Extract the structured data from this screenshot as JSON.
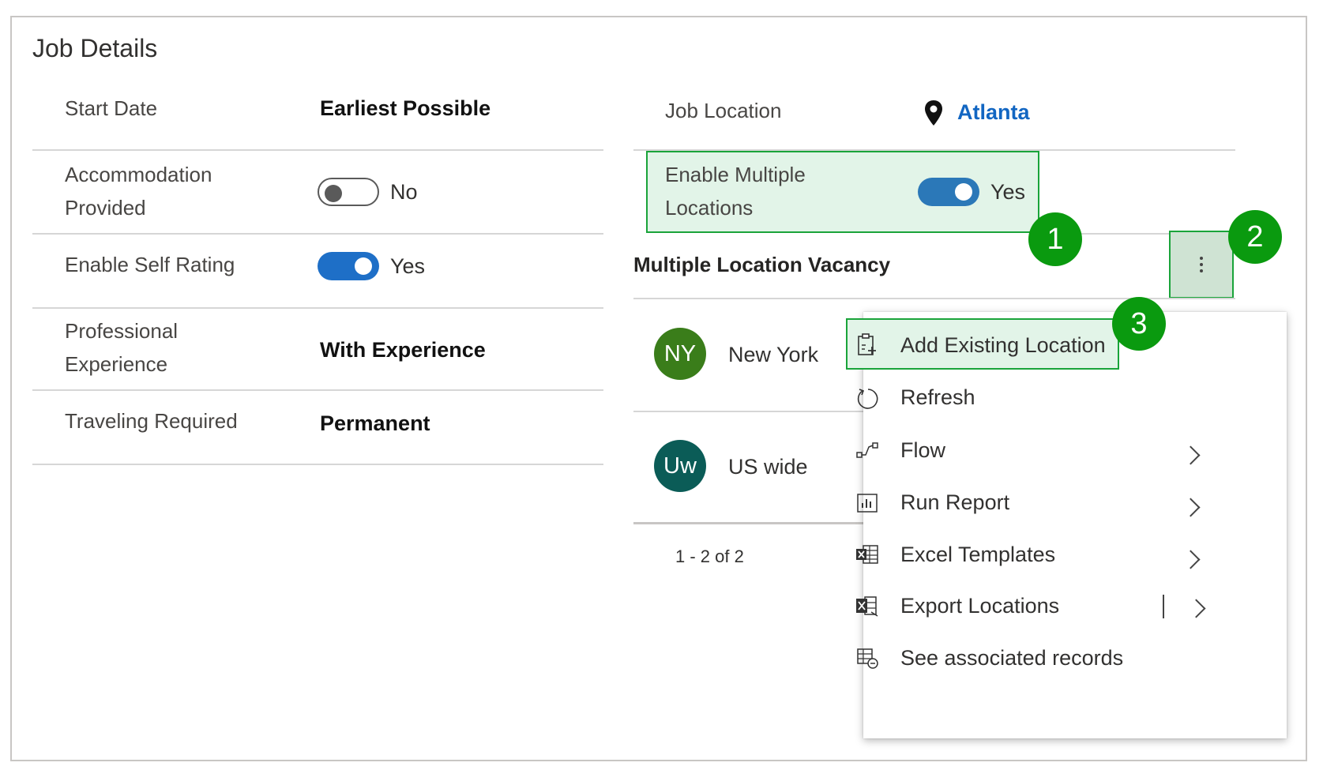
{
  "section": {
    "title": "Job Details"
  },
  "left_fields": {
    "start_date": {
      "label": "Start Date",
      "value": "Earliest Possible"
    },
    "accommodation": {
      "label_line1": "Accommodation",
      "label_line2": "Provided",
      "value": "No"
    },
    "self_rating": {
      "label": "Enable Self Rating",
      "value": "Yes"
    },
    "experience": {
      "label_line1": "Professional",
      "label_line2": "Experience",
      "value": "With Experience"
    },
    "traveling": {
      "label": "Traveling Required",
      "value": "Permanent"
    }
  },
  "right_fields": {
    "job_location": {
      "label": "Job Location",
      "value": "Atlanta"
    },
    "multiple_locations": {
      "label_line1": "Enable Multiple",
      "label_line2": "Locations",
      "value": "Yes"
    }
  },
  "subgrid": {
    "title": "Multiple Location Vacancy",
    "rows": [
      {
        "initials": "NY",
        "name": "New York",
        "color": "#3a7d1a"
      },
      {
        "initials": "Uw",
        "name": "US wide",
        "color": "#0b5c57"
      }
    ],
    "pagination": "1 - 2 of 2"
  },
  "menu": {
    "items": [
      {
        "label": "Add Existing Location",
        "icon": "clipboard-add-icon",
        "submenu": false
      },
      {
        "label": "Refresh",
        "icon": "refresh-icon",
        "submenu": false
      },
      {
        "label": "Flow",
        "icon": "flow-icon",
        "submenu": true
      },
      {
        "label": "Run Report",
        "icon": "report-icon",
        "submenu": true
      },
      {
        "label": "Excel Templates",
        "icon": "excel-template-icon",
        "submenu": true
      },
      {
        "label": "Export Locations",
        "icon": "excel-export-icon",
        "submenu": true
      },
      {
        "label": "See associated records",
        "icon": "associated-records-icon",
        "submenu": false
      }
    ]
  },
  "callouts": {
    "one": "1",
    "two": "2",
    "three": "3"
  },
  "colors": {
    "accent_green": "#0a9a0f",
    "highlight_fill": "#e2f4e8",
    "toggle_blue": "#1e6fc7",
    "link_blue": "#1266c2"
  }
}
